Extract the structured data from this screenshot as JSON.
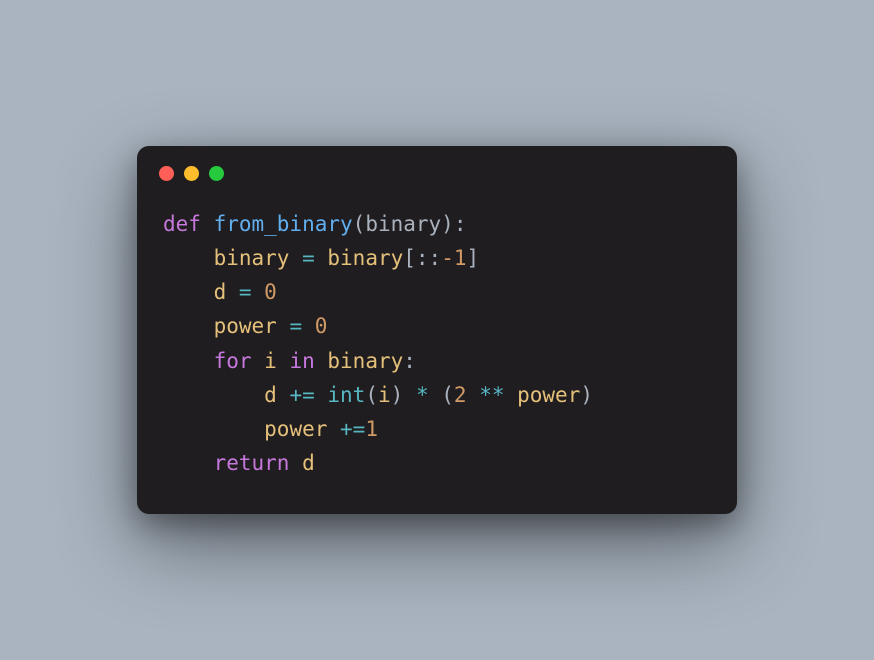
{
  "window": {
    "traffic_lights": [
      "close",
      "minimize",
      "zoom"
    ]
  },
  "code": {
    "lines": [
      {
        "indent": 0,
        "tokens": [
          {
            "t": "def ",
            "c": "kw"
          },
          {
            "t": "from_binary",
            "c": "fn"
          },
          {
            "t": "(",
            "c": "punct"
          },
          {
            "t": "binary",
            "c": "param"
          },
          {
            "t": "):",
            "c": "punct"
          }
        ]
      },
      {
        "indent": 1,
        "tokens": [
          {
            "t": "binary ",
            "c": "var"
          },
          {
            "t": "= ",
            "c": "op"
          },
          {
            "t": "binary",
            "c": "var"
          },
          {
            "t": "[::",
            "c": "punct"
          },
          {
            "t": "-1",
            "c": "num"
          },
          {
            "t": "]",
            "c": "punct"
          }
        ]
      },
      {
        "indent": 1,
        "tokens": [
          {
            "t": "d ",
            "c": "var"
          },
          {
            "t": "= ",
            "c": "op"
          },
          {
            "t": "0",
            "c": "num"
          }
        ]
      },
      {
        "indent": 1,
        "tokens": [
          {
            "t": "power ",
            "c": "var"
          },
          {
            "t": "= ",
            "c": "op"
          },
          {
            "t": "0",
            "c": "num"
          }
        ]
      },
      {
        "indent": 1,
        "tokens": [
          {
            "t": "for ",
            "c": "kw"
          },
          {
            "t": "i ",
            "c": "var"
          },
          {
            "t": "in ",
            "c": "kw"
          },
          {
            "t": "binary",
            "c": "var"
          },
          {
            "t": ":",
            "c": "punct"
          }
        ]
      },
      {
        "indent": 2,
        "tokens": [
          {
            "t": "d ",
            "c": "var"
          },
          {
            "t": "+= ",
            "c": "op"
          },
          {
            "t": "int",
            "c": "call"
          },
          {
            "t": "(",
            "c": "punct"
          },
          {
            "t": "i",
            "c": "var"
          },
          {
            "t": ") ",
            "c": "punct"
          },
          {
            "t": "* ",
            "c": "op"
          },
          {
            "t": "(",
            "c": "punct"
          },
          {
            "t": "2 ",
            "c": "num"
          },
          {
            "t": "** ",
            "c": "op"
          },
          {
            "t": "power",
            "c": "var"
          },
          {
            "t": ")",
            "c": "punct"
          }
        ]
      },
      {
        "indent": 2,
        "tokens": [
          {
            "t": "power ",
            "c": "var"
          },
          {
            "t": "+=",
            "c": "op"
          },
          {
            "t": "1",
            "c": "num"
          }
        ]
      },
      {
        "indent": 1,
        "tokens": [
          {
            "t": "return ",
            "c": "kw"
          },
          {
            "t": "d",
            "c": "var"
          }
        ]
      }
    ]
  }
}
